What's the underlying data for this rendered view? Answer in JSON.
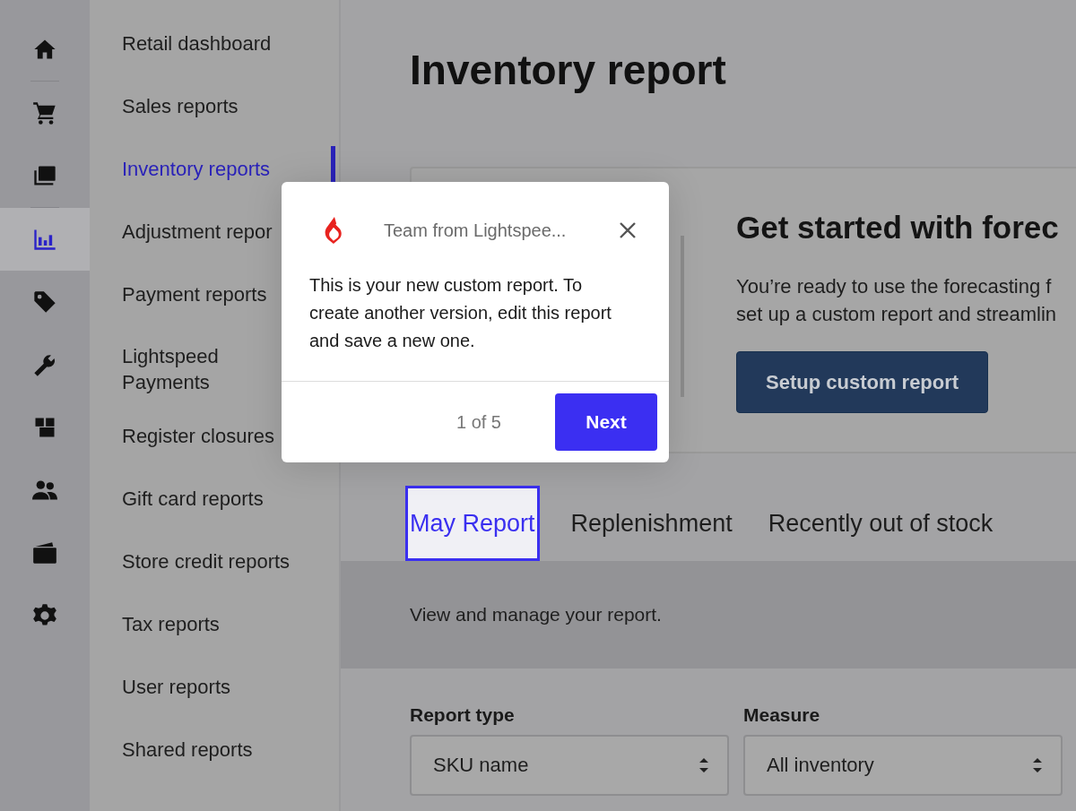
{
  "rail": [
    {
      "kind": "home",
      "selected": false
    },
    {
      "kind": "divider"
    },
    {
      "kind": "cart",
      "selected": false
    },
    {
      "kind": "stack",
      "selected": false
    },
    {
      "kind": "divider"
    },
    {
      "kind": "chart",
      "selected": true
    },
    {
      "kind": "tag",
      "selected": false
    },
    {
      "kind": "wrench",
      "selected": false
    },
    {
      "kind": "boxes",
      "selected": false
    },
    {
      "kind": "people",
      "selected": false
    },
    {
      "kind": "wallet",
      "selected": false
    },
    {
      "kind": "gear",
      "selected": false
    }
  ],
  "subnav": [
    {
      "label": "Retail dashboard",
      "selected": false
    },
    {
      "label": "Sales reports",
      "selected": false
    },
    {
      "label": "Inventory reports",
      "selected": true
    },
    {
      "label": "Adjustment repor",
      "selected": false
    },
    {
      "label": "Payment reports",
      "selected": false
    },
    {
      "label": "Lightspeed Payments",
      "selected": false
    },
    {
      "label": "Register closures",
      "selected": false
    },
    {
      "label": "Gift card reports",
      "selected": false
    },
    {
      "label": "Store credit reports",
      "selected": false
    },
    {
      "label": "Tax reports",
      "selected": false
    },
    {
      "label": "User reports",
      "selected": false
    },
    {
      "label": "Shared reports",
      "selected": false
    }
  ],
  "page_title": "Inventory report",
  "promo": {
    "title": "Get started with forec",
    "lines": [
      "You’re ready to use the forecasting f",
      "set up a custom report and streamlin"
    ],
    "button": "Setup custom report"
  },
  "tabs": [
    {
      "label": "May Report",
      "selected": true
    },
    {
      "label": "Replenishment",
      "selected": false
    },
    {
      "label": "Recently out of stock",
      "selected": false
    }
  ],
  "tab_description": "View and manage your report.",
  "filters": [
    {
      "label": "Report type",
      "value": "SKU name"
    },
    {
      "label": "Measure",
      "value": "All inventory"
    }
  ],
  "popup": {
    "sender": "Team from Lightspee...",
    "message": "This is your new custom report. To create another version, edit this report and save a new one.",
    "step": "1 of 5",
    "next": "Next"
  }
}
